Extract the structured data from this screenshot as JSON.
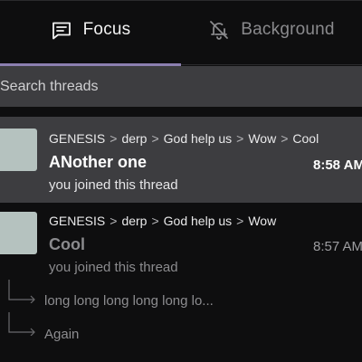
{
  "tabs": [
    {
      "label": "Focus",
      "icon": "message-square-icon",
      "active": true
    },
    {
      "label": "Background",
      "icon": "bell-off-icon",
      "active": false
    }
  ],
  "search": {
    "placeholder": "Search threads",
    "value": ""
  },
  "colors": {
    "background": "#0e0e0f",
    "highlight_row": "#3d3d40",
    "tab_indicator": "#8c7fb0",
    "avatar": "#b5c2bf",
    "muted_text": "#8b8b8e"
  },
  "threads": [
    {
      "breadcrumb": [
        "GENESIS",
        "derp",
        "God help us",
        "Wow",
        "Cool"
      ],
      "breadcrumb_separator": ">",
      "title": "ANother one",
      "subtitle": "you joined this thread",
      "time": "8:58 AM",
      "highlighted": true
    },
    {
      "breadcrumb": [
        "GENESIS",
        "derp",
        "God help us",
        "Wow"
      ],
      "breadcrumb_separator": ">",
      "title": "Cool",
      "subtitle": "you joined this thread",
      "time": "8:57 AM",
      "highlighted": false,
      "replies": [
        {
          "label": "long long long long long lo..."
        },
        {
          "label": "Again"
        }
      ]
    }
  ]
}
